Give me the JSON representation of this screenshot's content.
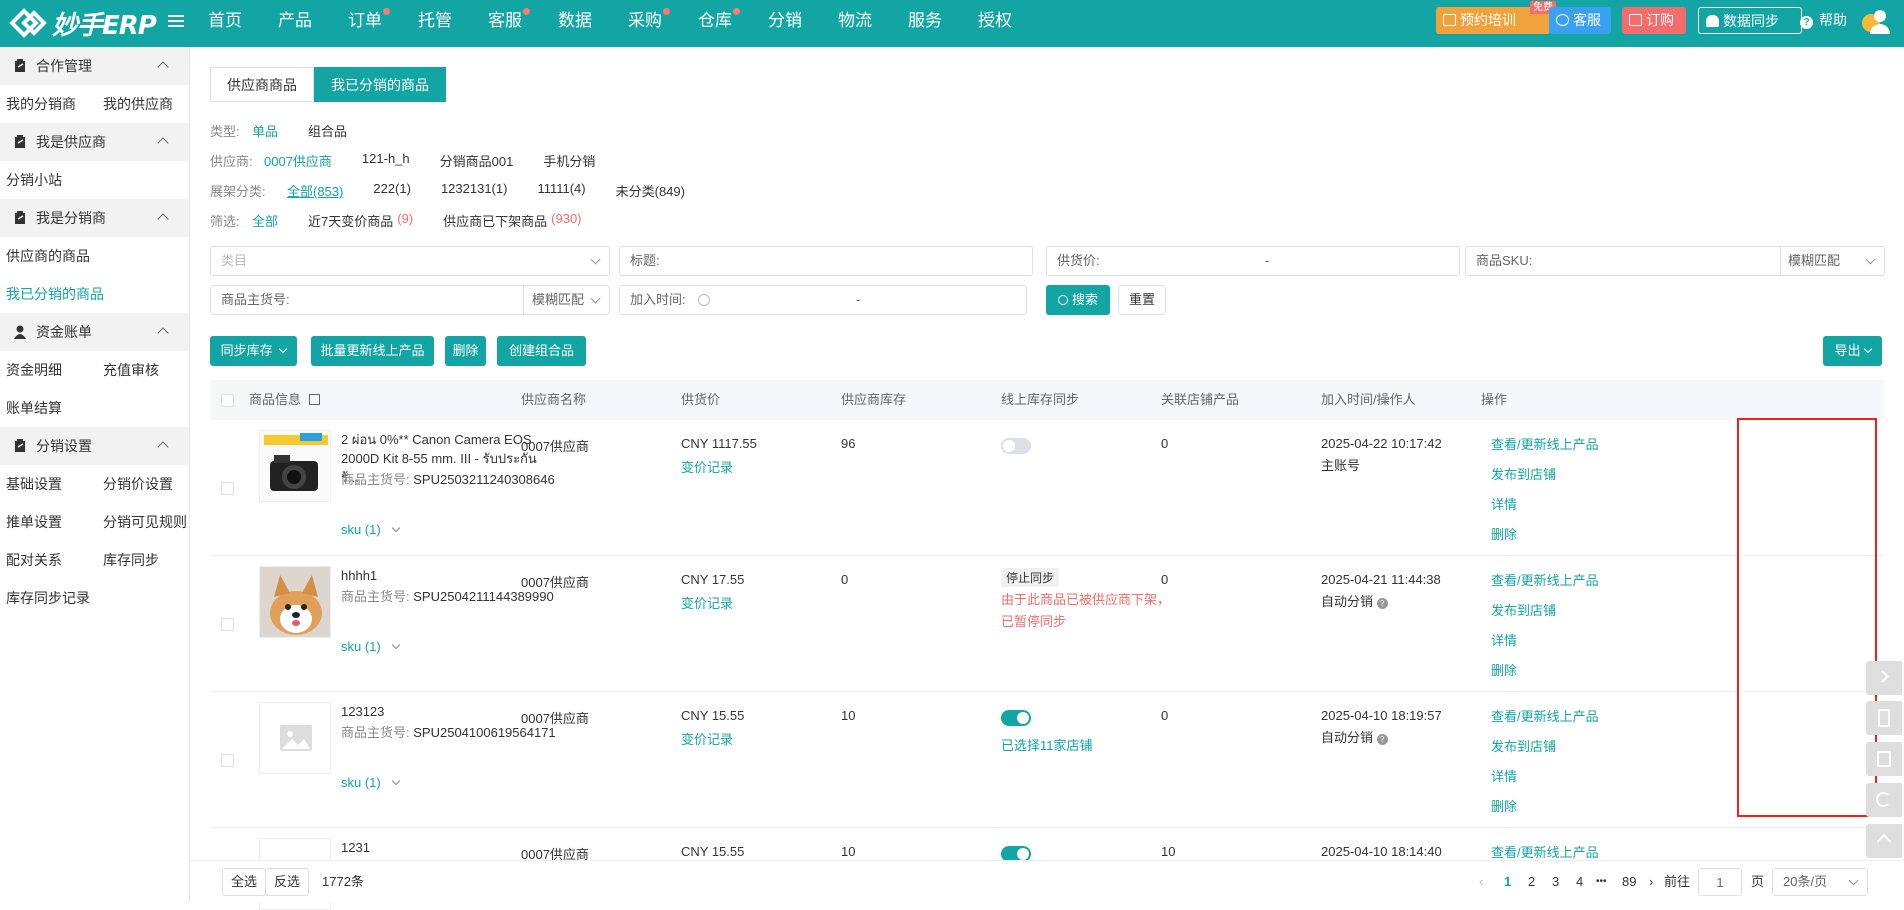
{
  "top": {
    "logo": "妙手ERP",
    "nav": [
      {
        "label": "首页",
        "dot": false
      },
      {
        "label": "产品",
        "dot": false
      },
      {
        "label": "订单",
        "dot": true
      },
      {
        "label": "托管",
        "dot": false
      },
      {
        "label": "客服",
        "dot": true
      },
      {
        "label": "数据",
        "dot": false
      },
      {
        "label": "采购",
        "dot": true
      },
      {
        "label": "仓库",
        "dot": true
      },
      {
        "label": "分销",
        "dot": false
      },
      {
        "label": "物流",
        "dot": false
      },
      {
        "label": "服务",
        "dot": false
      },
      {
        "label": "授权",
        "dot": false
      }
    ],
    "train": "预约培训",
    "free": "免费",
    "cs": "客服",
    "order": "订购",
    "sync": "数据同步",
    "help": "帮助"
  },
  "sidebar": {
    "g1": "合作管理",
    "g1_a": "我的分销商",
    "g1_b": "我的供应商",
    "g2": "我是供应商",
    "g2_a": "分销小站",
    "g3": "我是分销商",
    "g3_a": "供应商的商品",
    "g3_b": "我已分销的商品",
    "g4": "资金账单",
    "g4_a": "资金明细",
    "g4_b": "充值审核",
    "g4_c": "账单结算",
    "g5": "分销设置",
    "g5_a": "基础设置",
    "g5_b": "分销价设置",
    "g5_c": "推单设置",
    "g5_d": "分销可见规则",
    "g5_e": "配对关系",
    "g5_f": "库存同步",
    "g5_g": "库存同步记录"
  },
  "tabs": {
    "t1": "供应商商品",
    "t2": "我已分销的商品"
  },
  "filters": {
    "type_label": "类型:",
    "type_a": "单品",
    "type_b": "组合品",
    "sup_label": "供应商:",
    "sup_a": "0007供应商",
    "sup_b": "121-h_h",
    "sup_c": "分销商品001",
    "sup_d": "手机分销",
    "cat_label": "展架分类:",
    "cat_a": "全部(853)",
    "cat_b": "222(1)",
    "cat_c": "1232131(1)",
    "cat_d": "11111(4)",
    "cat_e": "未分类(849)",
    "scr_label": "筛选:",
    "scr_a": "全部",
    "scr_b": "近7天变价商品",
    "scr_b_n": "(9)",
    "scr_c": "供应商已下架商品",
    "scr_c_n": "(930)"
  },
  "search": {
    "category_ph": "类目",
    "title_label": "标题:",
    "price_label": "供货价:",
    "dash": "-",
    "sku_label": "商品SKU:",
    "match": "模糊匹配",
    "spu_label": "商品主货号:",
    "match2": "模糊匹配",
    "time_label": "加入时间:",
    "search_btn": "搜索",
    "reset_btn": "重置"
  },
  "actions": {
    "sync_stock": "同步库存",
    "batch_update": "批量更新线上产品",
    "delete": "删除",
    "create_combo": "创建组合品",
    "export": "导出"
  },
  "table": {
    "headers": {
      "info": "商品信息",
      "sup": "供应商名称",
      "price": "供货价",
      "stock": "供应商库存",
      "online": "线上库存同步",
      "shop": "关联店铺产品",
      "time": "加入时间/操作人",
      "ops": "操作"
    },
    "spu_label": "商品主货号:",
    "price_log": "变价记录",
    "op_view": "查看/更新线上产品",
    "op_publish": "发布到店铺",
    "op_detail": "详情",
    "op_delete": "删除",
    "rows": [
      {
        "title": "2 ผ่อน 0%** Canon Camera EOS 2000D Kit 8-55 mm. III - รับประกันร้...",
        "spu": "SPU2503211240308646",
        "sku": "sku (1)",
        "sup": "0007供应商",
        "price": "CNY 1117.55",
        "stock": "96",
        "shop": "0",
        "time": "2025-04-22 10:17:42",
        "who": "主账号"
      },
      {
        "title": "hhhh1",
        "spu": "SPU2504211144389990",
        "sku": "sku (1)",
        "sup": "0007供应商",
        "price": "CNY 17.55",
        "stock": "0",
        "stop": "停止同步",
        "stop_reason": "由于此商品已被供应商下架，已暂停同步",
        "shop": "0",
        "time": "2025-04-21 11:44:38",
        "who": "自动分销"
      },
      {
        "title": "123123",
        "spu": "SPU2504100619564171",
        "sku": "sku (1)",
        "sup": "0007供应商",
        "price": "CNY 15.55",
        "stock": "10",
        "selected": "已选择11家店铺",
        "shop": "0",
        "time": "2025-04-10 18:19:57",
        "who": "自动分销"
      },
      {
        "title": "1231",
        "sup": "0007供应商",
        "price": "CNY 15.55",
        "stock": "10",
        "shop": "10",
        "time": "2025-04-10 18:14:40"
      }
    ]
  },
  "footer": {
    "select_all": "全选",
    "invert": "反选",
    "count": "1772条",
    "p1": "1",
    "p2": "2",
    "p3": "3",
    "p4": "4",
    "more": "•••",
    "p89": "89",
    "goto": "前往",
    "page_val": "1",
    "page_unit": "页",
    "size": "20条/页"
  },
  "colors": {
    "brand": "#13a4a4",
    "danger": "#f56c6c",
    "highlight": "#f02020"
  }
}
